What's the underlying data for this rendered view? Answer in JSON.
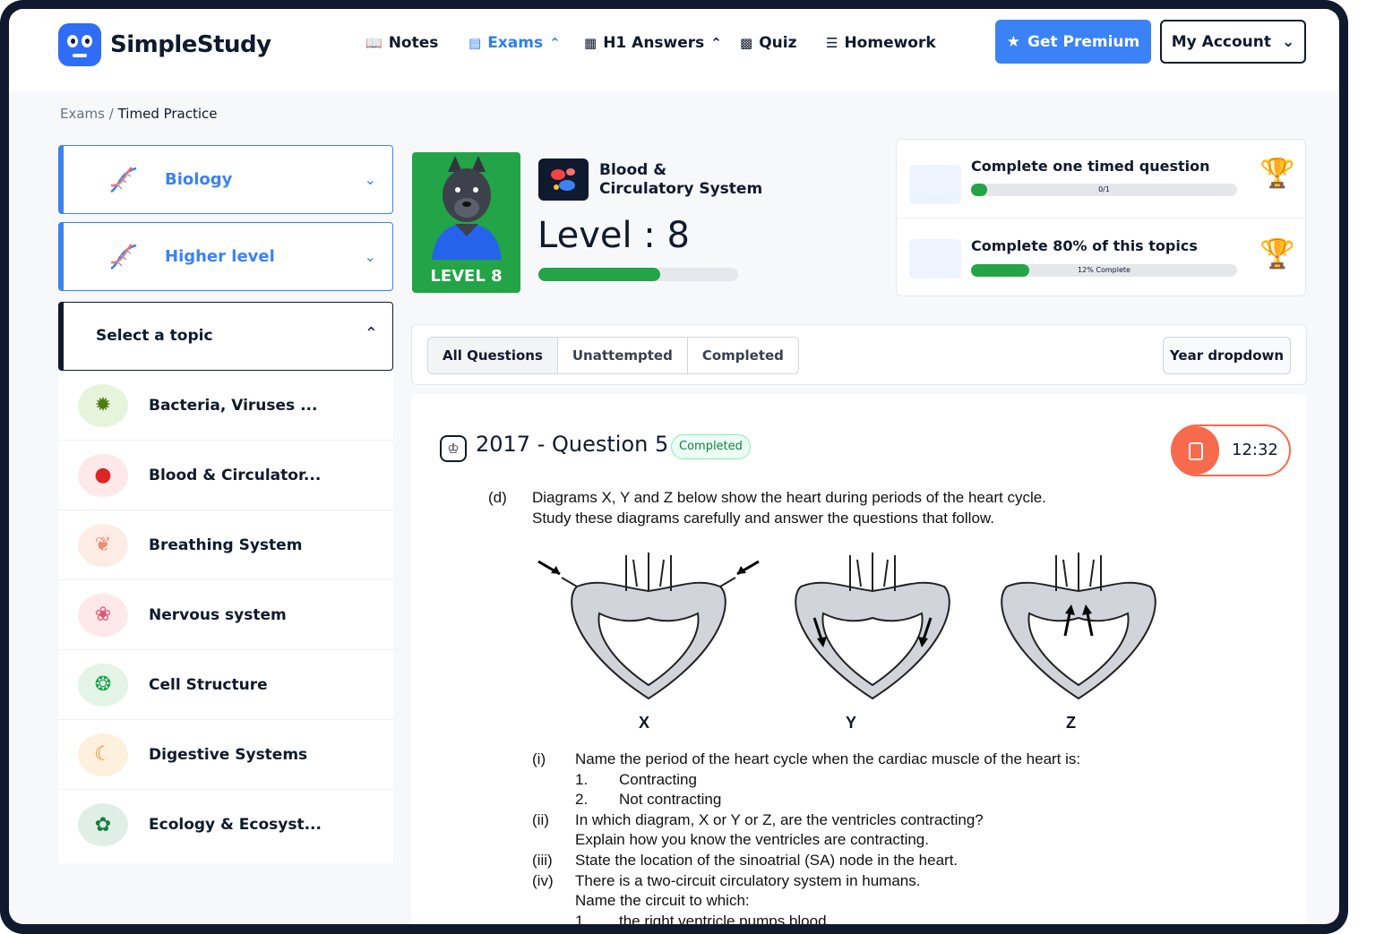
{
  "brand": {
    "name": "SimpleStudy"
  },
  "nav": [
    {
      "label": "Notes",
      "icon": "book-icon"
    },
    {
      "label": "Exams",
      "icon": "exam-icon",
      "active": true
    },
    {
      "label": "H1 Answers",
      "icon": "answers-icon"
    },
    {
      "label": "Quiz",
      "icon": "quiz-icon"
    },
    {
      "label": "Homework",
      "icon": "homework-icon"
    }
  ],
  "header": {
    "premium_label": "Get Premium",
    "account_label": "My Account"
  },
  "breadcrumb": {
    "root": "Exams",
    "sep": "/",
    "current": "Timed Practice"
  },
  "sidebar": {
    "subject": "Biology",
    "level": "Higher level",
    "topic_placeholder": "Select a topic",
    "topics": [
      {
        "label": "Bacteria, Viruses ...",
        "icon": "bacteria-icon"
      },
      {
        "label": "Blood & Circulator...",
        "icon": "blood-cells-icon"
      },
      {
        "label": "Breathing System",
        "icon": "lungs-icon"
      },
      {
        "label": "Nervous system",
        "icon": "brain-icon"
      },
      {
        "label": "Cell Structure",
        "icon": "cell-icon"
      },
      {
        "label": "Digestive Systems",
        "icon": "stomach-icon"
      },
      {
        "label": "Ecology & Ecosyst...",
        "icon": "globe-leaf-icon"
      }
    ]
  },
  "level": {
    "badge": "LEVEL 8",
    "topic_line1": "Blood &",
    "topic_line2": "Circulatory System",
    "text": "Level : 8",
    "progress": 0.61
  },
  "goals": [
    {
      "title": "Complete one timed question",
      "progress_text": "0/1",
      "progress": 0.06
    },
    {
      "title": "Complete 80% of this topics",
      "progress_text": "12% Complete",
      "progress": 0.22
    }
  ],
  "filters": {
    "tabs": [
      "All Questions",
      "Unattempted",
      "Completed"
    ],
    "year": "Year dropdown"
  },
  "question": {
    "title": "2017 - Question 5",
    "status": "Completed",
    "timer": "12:32",
    "part": "(d)",
    "intro1": "Diagrams X, Y and Z below show the heart during periods of the heart cycle.",
    "intro2": "Study these diagrams carefully and answer the questions that follow.",
    "diagram_labels": [
      "X",
      "Y",
      "Z"
    ],
    "lines": [
      {
        "num": "(i)",
        "text": "Name the period of the heart cycle when the cardiac muscle of the heart is:"
      },
      {
        "num": "1.",
        "text": "Contracting"
      },
      {
        "num": "2.",
        "text": "Not contracting"
      },
      {
        "num": "(ii)",
        "text": "In which diagram, X or Y or Z, are the ventricles contracting?"
      },
      {
        "num": "",
        "text": "Explain how you know the ventricles are contracting."
      },
      {
        "num": "(iii)",
        "text": "State the location of the sinoatrial (SA) node in the heart."
      },
      {
        "num": "(iv)",
        "text": "There is a two-circuit circulatory system in humans."
      },
      {
        "num": "",
        "text": "Name the circuit to which:"
      },
      {
        "num": "1.",
        "text": "the right ventricle pumps blood."
      }
    ]
  }
}
